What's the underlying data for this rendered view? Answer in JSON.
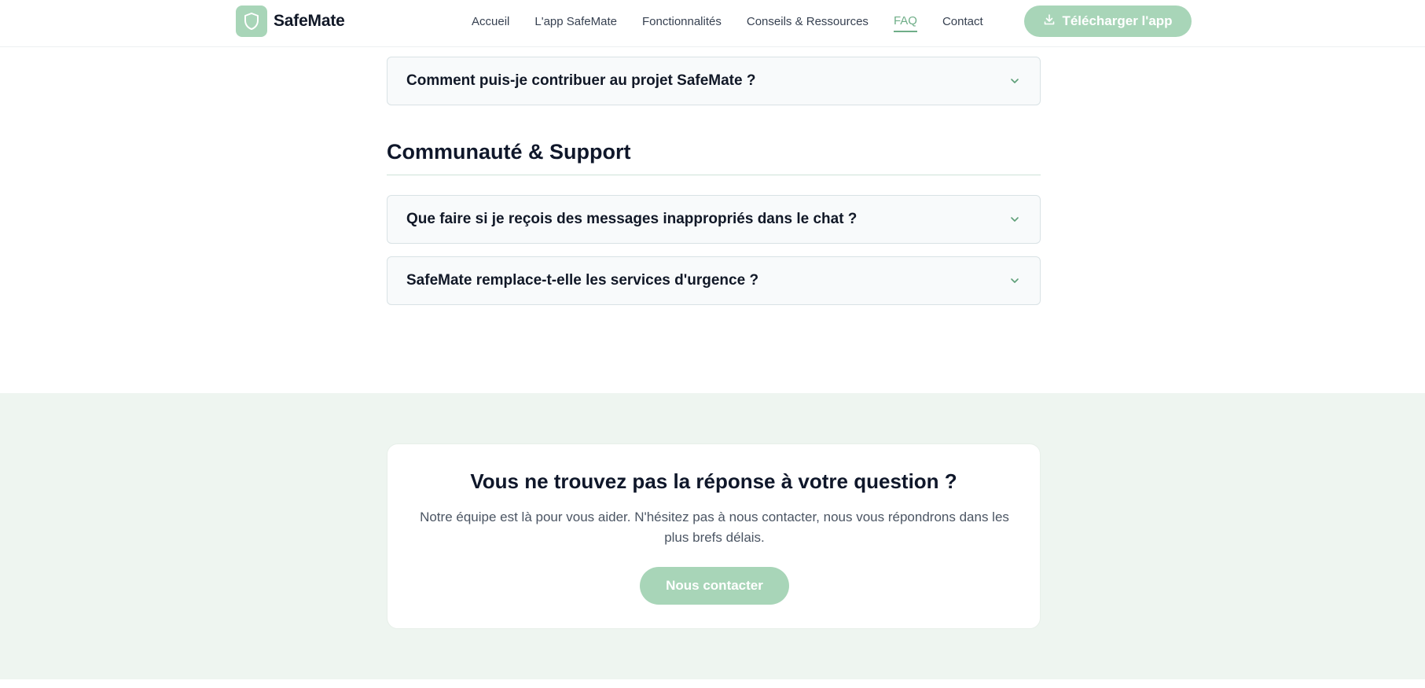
{
  "header": {
    "brand": "SafeMate",
    "nav": [
      {
        "label": "Accueil"
      },
      {
        "label": "L'app SafeMate"
      },
      {
        "label": "Fonctionnalités"
      },
      {
        "label": "Conseils & Ressources"
      },
      {
        "label": "FAQ",
        "active": true
      },
      {
        "label": "Contact"
      }
    ],
    "download_label": "Télécharger l'app"
  },
  "faq": {
    "prev_section_items": [
      {
        "question": "Comment puis-je contribuer au projet SafeMate ?"
      }
    ],
    "section": {
      "title": "Communauté & Support",
      "items": [
        {
          "question": "Que faire si je reçois des messages inappropriés dans le chat ?"
        },
        {
          "question": "SafeMate remplace-t-elle les services d'urgence ?"
        }
      ]
    }
  },
  "cta": {
    "title": "Vous ne trouvez pas la réponse à votre question ?",
    "text": "Notre équipe est là pour vous aider. N'hésitez pas à nous contacter, nous vous répondrons dans les plus brefs délais.",
    "button_label": "Nous contacter"
  },
  "colors": {
    "accent": "#a8d5b8",
    "accent_text": "#6fae88",
    "band_bg": "#eef5f0"
  }
}
